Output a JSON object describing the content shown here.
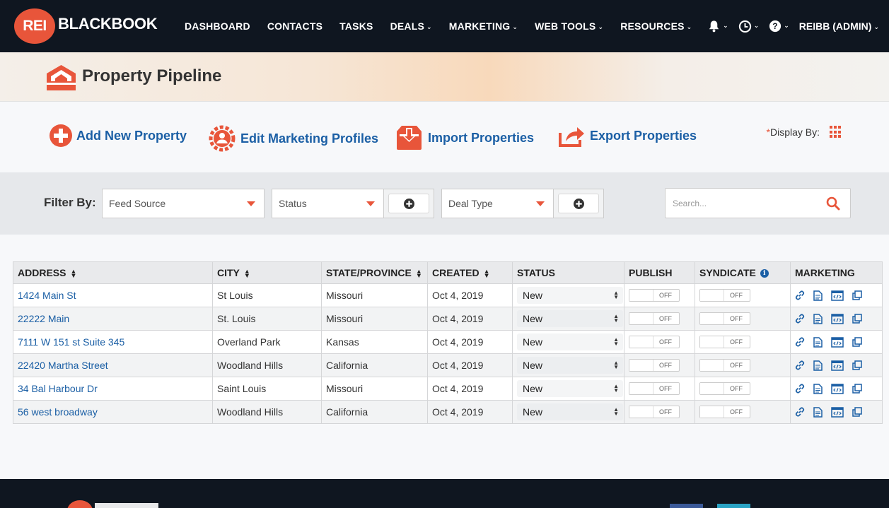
{
  "brand": {
    "mark": "REI",
    "name": "BLACKBOOK"
  },
  "nav": {
    "items": [
      {
        "label": "DASHBOARD",
        "dropdown": false
      },
      {
        "label": "CONTACTS",
        "dropdown": false
      },
      {
        "label": "TASKS",
        "dropdown": false
      },
      {
        "label": "DEALS",
        "dropdown": true
      },
      {
        "label": "MARKETING",
        "dropdown": true
      },
      {
        "label": "WEB TOOLS",
        "dropdown": true
      },
      {
        "label": "RESOURCES",
        "dropdown": true
      }
    ],
    "user": "REIBB (ADMIN)"
  },
  "page": {
    "title": "Property Pipeline"
  },
  "actions": {
    "add": "Add New Property",
    "edit": "Edit Marketing Profiles",
    "import": "Import Properties",
    "export": "Export Properties",
    "display_by_star": "*",
    "display_by": "Display By:"
  },
  "filter": {
    "label": "Filter By:",
    "feed_source": "Feed Source",
    "status": "Status",
    "deal_type": "Deal Type",
    "search_placeholder": "Search..."
  },
  "table": {
    "headers": {
      "address": "ADDRESS",
      "city": "CITY",
      "state": "STATE/PROVINCE",
      "created": "CREATED",
      "status": "STATUS",
      "publish": "PUBLISH",
      "syndicate": "SYNDICATE",
      "marketing": "MARKETING"
    },
    "toggle_off": "OFF",
    "rows": [
      {
        "address": "1424 Main St",
        "city": "St Louis",
        "state": "Missouri",
        "created": "Oct 4, 2019",
        "status": "New"
      },
      {
        "address": "22222 Main",
        "city": "St. Louis",
        "state": "Missouri",
        "created": "Oct 4, 2019",
        "status": "New"
      },
      {
        "address": "7111 W 151 st Suite 345",
        "city": "Overland Park",
        "state": "Kansas",
        "created": "Oct 4, 2019",
        "status": "New"
      },
      {
        "address": "22420 Martha Street",
        "city": "Woodland Hills",
        "state": "California",
        "created": "Oct 4, 2019",
        "status": "New"
      },
      {
        "address": "34 Bal Harbour Dr",
        "city": "Saint Louis",
        "state": "Missouri",
        "created": "Oct 4, 2019",
        "status": "New"
      },
      {
        "address": "56 west broadway",
        "city": "Woodland Hills",
        "state": "California",
        "created": "Oct 4, 2019",
        "status": "New"
      }
    ]
  },
  "colors": {
    "accent": "#e8553a",
    "link": "#1b5fa5",
    "nav_bg": "#0f1620"
  }
}
